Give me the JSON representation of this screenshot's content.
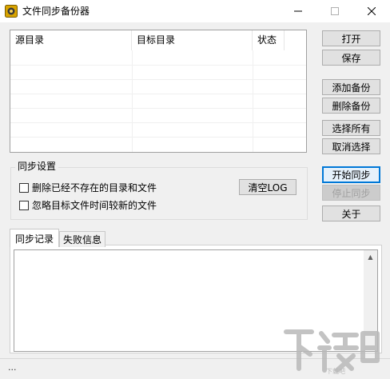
{
  "window": {
    "title": "文件同步备份器"
  },
  "table": {
    "columns": [
      "源目录",
      "目标目录",
      "状态"
    ],
    "rows": []
  },
  "buttons": {
    "open": "打开",
    "save": "保存",
    "add_backup": "添加备份",
    "delete_backup": "删除备份",
    "select_all": "选择所有",
    "deselect": "取消选择",
    "start_sync": "开始同步",
    "stop_sync": "停止同步",
    "about": "关于",
    "clear_log": "清空LOG"
  },
  "settings": {
    "legend": "同步设置",
    "options": [
      {
        "label": "删除已经不存在的目录和文件",
        "checked": false
      },
      {
        "label": "忽略目标文件时间较新的文件",
        "checked": false
      }
    ]
  },
  "tabs": [
    {
      "label": "同步记录",
      "active": true
    },
    {
      "label": "失败信息",
      "active": false
    }
  ],
  "log": {
    "content": ""
  },
  "status": {
    "text": "..."
  },
  "watermark": {
    "text": "下载吧"
  },
  "icons": {
    "app": "app-logo-icon",
    "minimize": "minimize-icon",
    "maximize": "maximize-icon",
    "close": "close-icon"
  },
  "colors": {
    "accent": "#0078d7",
    "watermark": "#b9b9b9"
  }
}
